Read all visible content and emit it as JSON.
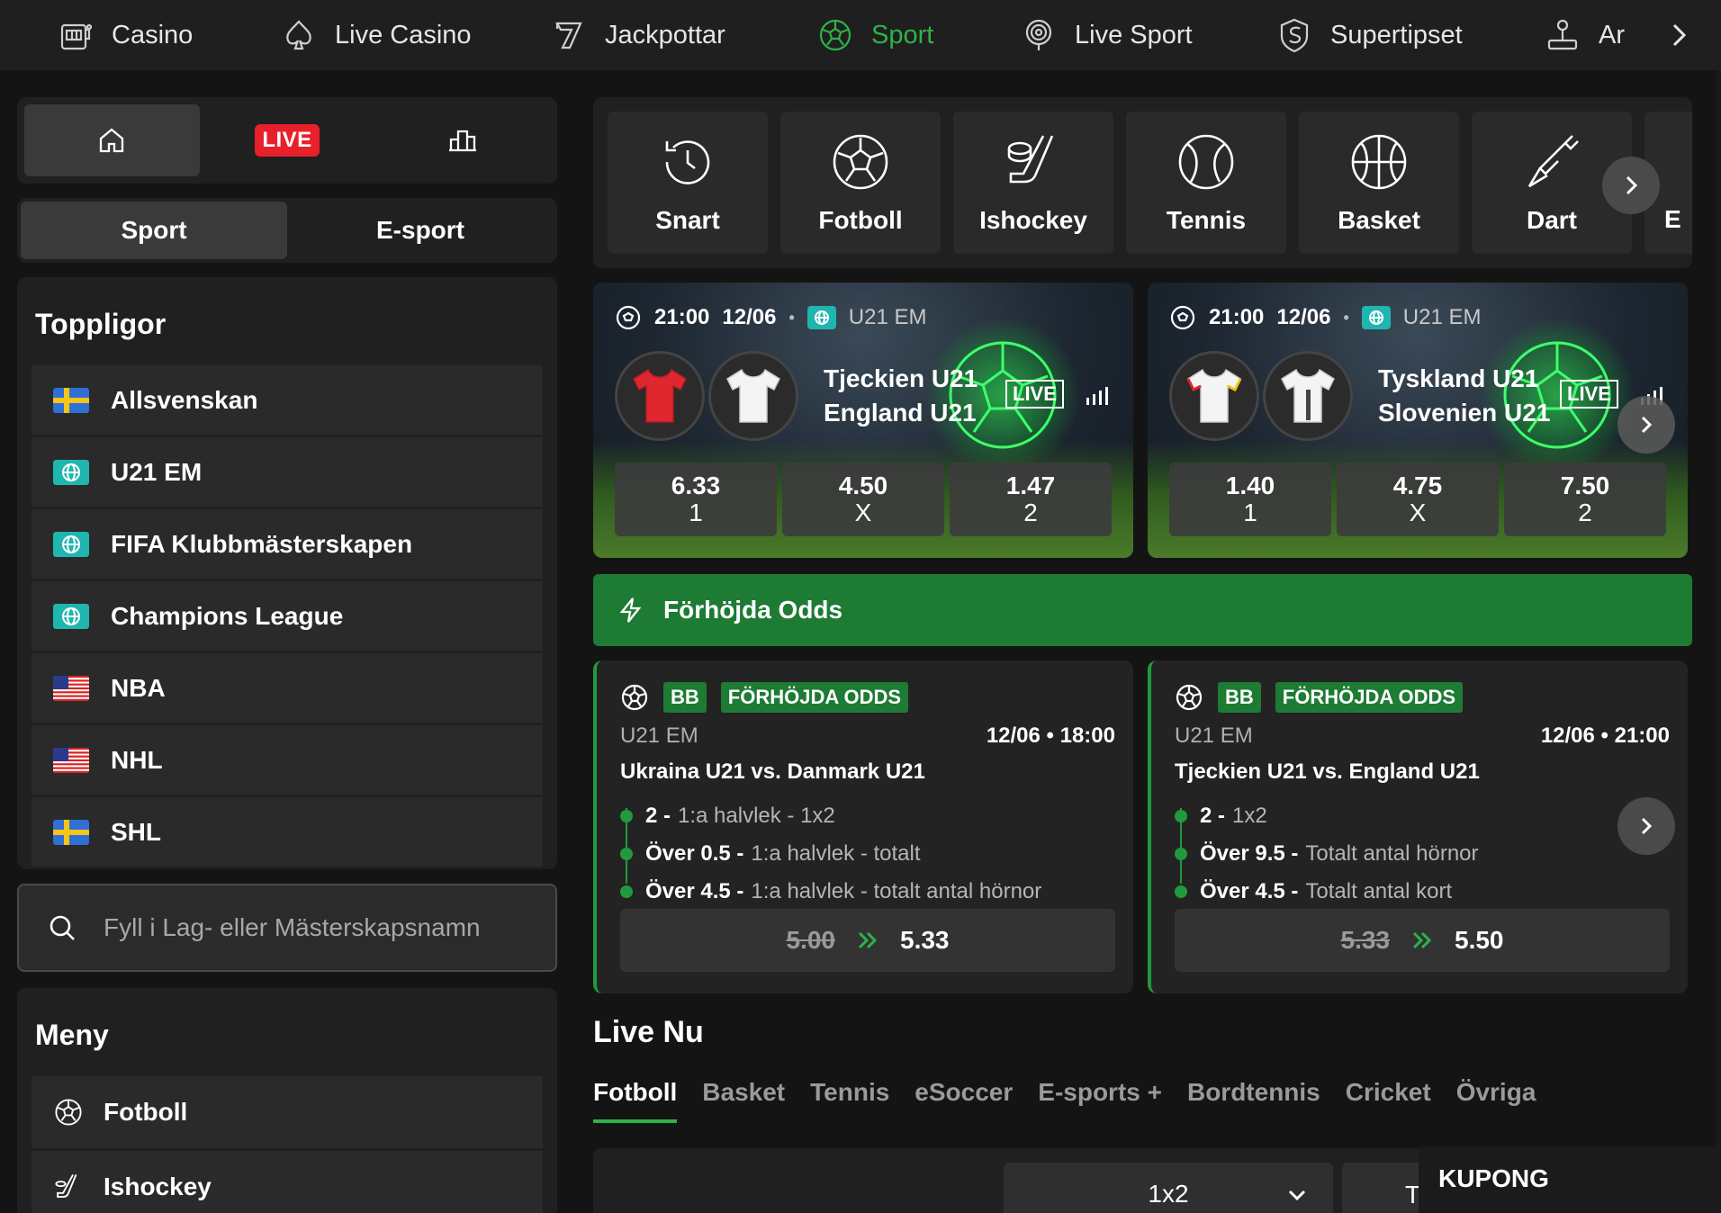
{
  "topnav": {
    "items": [
      {
        "label": "Casino",
        "icon": "slot-machine-icon"
      },
      {
        "label": "Live Casino",
        "icon": "spade-icon"
      },
      {
        "label": "Jackpottar",
        "icon": "seven-icon"
      },
      {
        "label": "Sport",
        "icon": "football-icon",
        "active": true
      },
      {
        "label": "Live Sport",
        "icon": "live-target-icon"
      },
      {
        "label": "Supertipset",
        "icon": "s-logo-icon"
      },
      {
        "label": "Ar",
        "icon": "joystick-icon"
      }
    ]
  },
  "home_tabs": {
    "live_label": "LIVE"
  },
  "sport_switch": {
    "sport": "Sport",
    "esport": "E-sport"
  },
  "toppligor": {
    "title": "Toppligor",
    "items": [
      {
        "label": "Allsvenskan",
        "icon": "flag-sweden"
      },
      {
        "label": "U21 EM",
        "icon": "globe-icon"
      },
      {
        "label": "FIFA Klubbmästerskapen",
        "icon": "globe-icon"
      },
      {
        "label": "Champions League",
        "icon": "globe-icon"
      },
      {
        "label": "NBA",
        "icon": "flag-usa"
      },
      {
        "label": "NHL",
        "icon": "flag-usa"
      },
      {
        "label": "SHL",
        "icon": "flag-sweden"
      }
    ]
  },
  "search": {
    "placeholder": "Fyll i Lag- eller Mästerskapsnamn"
  },
  "meny": {
    "title": "Meny",
    "items": [
      {
        "label": "Fotboll",
        "icon": "football-icon"
      },
      {
        "label": "Ishockey",
        "icon": "hockey-icon"
      }
    ]
  },
  "sports": [
    {
      "label": "Snart",
      "icon": "history-clock-icon"
    },
    {
      "label": "Fotboll",
      "icon": "football-icon"
    },
    {
      "label": "Ishockey",
      "icon": "hockey-icon"
    },
    {
      "label": "Tennis",
      "icon": "tennis-ball-icon"
    },
    {
      "label": "Basket",
      "icon": "basketball-icon"
    },
    {
      "label": "Dart",
      "icon": "dart-icon"
    },
    {
      "label": "E",
      "icon": ""
    }
  ],
  "live_matches": [
    {
      "time": "21:00",
      "date": "12/06",
      "competition": "U21 EM",
      "home": "Tjeckien U21",
      "away": "England U21",
      "live": "LIVE",
      "odds": [
        {
          "value": "6.33",
          "label": "1"
        },
        {
          "value": "4.50",
          "label": "X"
        },
        {
          "value": "1.47",
          "label": "2"
        }
      ]
    },
    {
      "time": "21:00",
      "date": "12/06",
      "competition": "U21 EM",
      "home": "Tyskland U21",
      "away": "Slovenien U21",
      "live": "LIVE",
      "odds": [
        {
          "value": "1.40",
          "label": "1"
        },
        {
          "value": "4.75",
          "label": "X"
        },
        {
          "value": "7.50",
          "label": "2"
        }
      ]
    }
  ],
  "boosted": {
    "title": "Förhöjda Odds",
    "cards": [
      {
        "tag_bb": "BB",
        "tag": "FÖRHÖJDA ODDS",
        "competition": "U21 EM",
        "datetime": "12/06 • 18:00",
        "match": "Ukraina U21 vs. Danmark U21",
        "selections": [
          {
            "pick": "2 -",
            "market": "1:a halvlek - 1x2"
          },
          {
            "pick": "Över 0.5 -",
            "market": "1:a halvlek - totalt"
          },
          {
            "pick": "Över 4.5 -",
            "market": "1:a halvlek - totalt antal hörnor"
          }
        ],
        "old_odds": "5.00",
        "new_odds": "5.33"
      },
      {
        "tag_bb": "BB",
        "tag": "FÖRHÖJDA ODDS",
        "competition": "U21 EM",
        "datetime": "12/06 • 21:00",
        "match": "Tjeckien U21 vs. England U21",
        "selections": [
          {
            "pick": "2 -",
            "market": "1x2"
          },
          {
            "pick": "Över 9.5 -",
            "market": "Totalt antal hörnor"
          },
          {
            "pick": "Över 4.5 -",
            "market": "Totalt antal kort"
          }
        ],
        "old_odds": "5.33",
        "new_odds": "5.50"
      }
    ]
  },
  "live_nu": {
    "title": "Live Nu",
    "tabs": [
      "Fotboll",
      "Basket",
      "Tennis",
      "eSoccer",
      "E-sports +",
      "Bordtennis",
      "Cricket",
      "Övriga"
    ],
    "market_select": "1x2",
    "market_select2": "To"
  },
  "kupong": {
    "label": "KUPONG"
  },
  "colors": {
    "accent": "#2cb34a",
    "banner": "#1e7b34",
    "live_red": "#e8202a",
    "globe_teal": "#1fb6b0"
  }
}
